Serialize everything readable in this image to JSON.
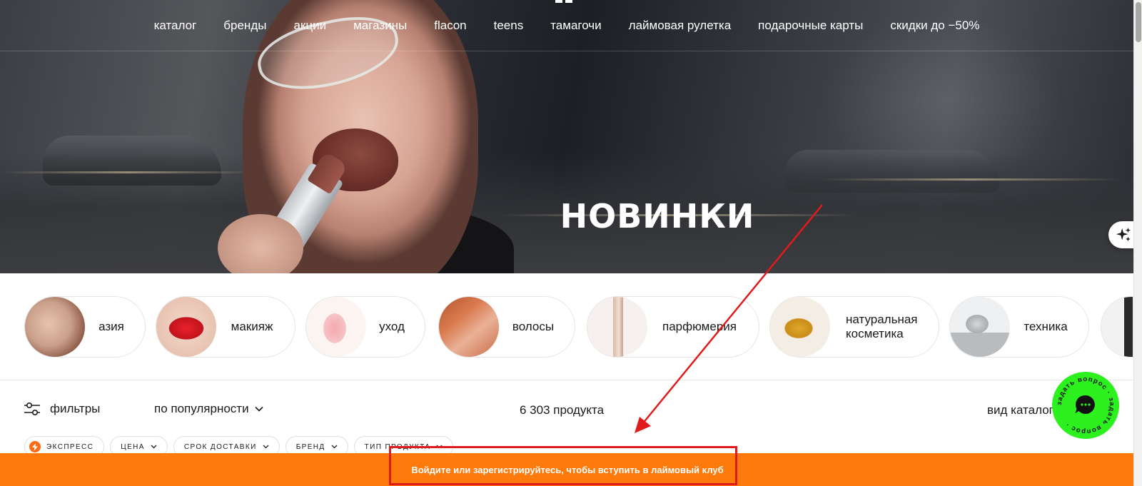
{
  "nav": {
    "items": [
      "каталог",
      "бренды",
      "акции",
      "магазины",
      "flacon",
      "teens",
      "тамагочи",
      "лаймовая рулетка",
      "подарочные карты",
      "скидки до −50%"
    ]
  },
  "hero": {
    "title": "НОВИНКИ"
  },
  "categories": [
    {
      "label": "азия",
      "image": "face-mask-photo"
    },
    {
      "label": "макияж",
      "image": "red-lips-photo"
    },
    {
      "label": "уход",
      "image": "pink-gel-swatch"
    },
    {
      "label": "волосы",
      "image": "red-hair-photo"
    },
    {
      "label": "парфюмерия",
      "image": "perfume-bottle-photo"
    },
    {
      "label": "натуральная косметика",
      "image": "golden-balm-swatch"
    },
    {
      "label": "техника",
      "image": "hair-dryer-photo"
    }
  ],
  "toolbar": {
    "filters_label": "фильтры",
    "sort_label": "по популярности",
    "count_label": "6 303 продукта",
    "view_label": "вид каталога"
  },
  "chips": [
    "экспресс",
    "цена",
    "срок доставки",
    "бренд",
    "тип продукта"
  ],
  "banner": {
    "text": "Войдите или зарегистрируйтесь, чтобы вступить в лаймовый клуб"
  },
  "chat": {
    "ring_text": "задать вопрос · задать вопрос · "
  },
  "colors": {
    "brand_orange": "#ff7a0d",
    "lime": "#2df01f",
    "annotation_red": "#e01b1b"
  }
}
